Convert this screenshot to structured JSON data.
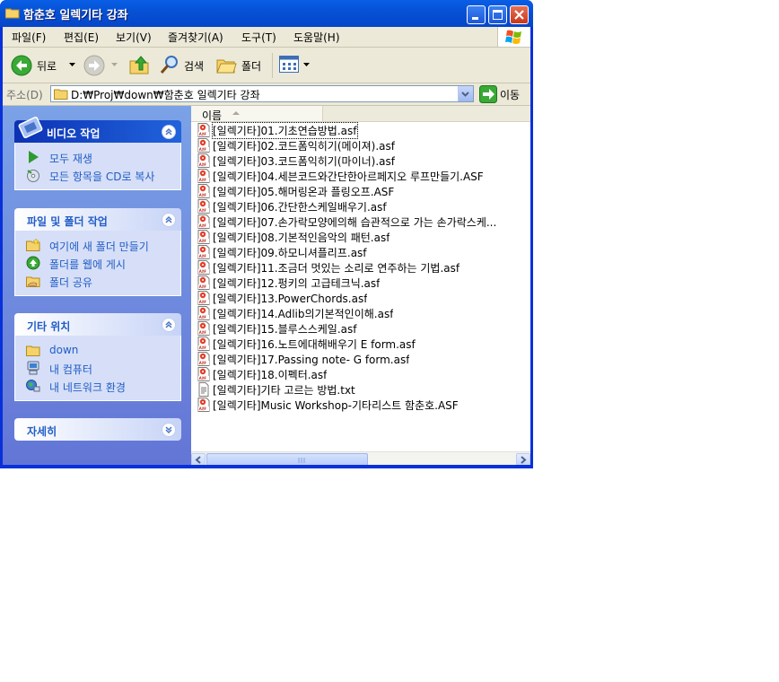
{
  "window": {
    "title": "함춘호 일렉기타 강좌",
    "minimize_icon": "minimize-icon",
    "maximize_icon": "maximize-icon",
    "close_icon": "close-icon"
  },
  "menu": [
    {
      "label": "파일(F)"
    },
    {
      "label": "편집(E)"
    },
    {
      "label": "보기(V)"
    },
    {
      "label": "즐겨찾기(A)"
    },
    {
      "label": "도구(T)"
    },
    {
      "label": "도움말(H)"
    }
  ],
  "toolbar": {
    "back_label": "뒤로",
    "search_label": "검색",
    "folders_label": "폴더"
  },
  "address": {
    "label": "주소(D)",
    "value": "D:₩Proj₩down₩함춘호 일렉기타 강좌",
    "go_label": "이동"
  },
  "tasks": {
    "video": {
      "title": "비디오 작업",
      "items": [
        {
          "label": "모두 재생",
          "icon": "play-icon"
        },
        {
          "label": "모든 항목을 CD로 복사",
          "icon": "burn-cd-icon"
        }
      ]
    },
    "file": {
      "title": "파일 및 폴더 작업",
      "items": [
        {
          "label": "여기에 새 폴더 만들기",
          "icon": "new-folder-icon"
        },
        {
          "label": "폴더를 웹에 게시",
          "icon": "publish-web-icon"
        },
        {
          "label": "폴더 공유",
          "icon": "share-folder-icon"
        }
      ]
    },
    "places": {
      "title": "기타 위치",
      "items": [
        {
          "label": "down",
          "icon": "folder-icon"
        },
        {
          "label": "내 컴퓨터",
          "icon": "computer-icon"
        },
        {
          "label": "내 네트워크 환경",
          "icon": "network-icon"
        }
      ]
    },
    "details": {
      "title": "자세히"
    }
  },
  "list": {
    "column_name": "이름",
    "files": [
      {
        "name": "[일렉기타]01.기초연습방법.asf",
        "type": "asf"
      },
      {
        "name": "[일렉기타]02.코드폼익히기(메이져).asf",
        "type": "asf"
      },
      {
        "name": "[일렉기타]03.코드폼익히기(마이너).asf",
        "type": "asf"
      },
      {
        "name": "[일렉기타]04.세븐코드와간단한아르페지오 루프만들기.ASF",
        "type": "asf"
      },
      {
        "name": "[일렉기타]05.해머링온과 플링오프.ASF",
        "type": "asf"
      },
      {
        "name": "[일렉기타]06.간단한스케일배우기.asf",
        "type": "asf"
      },
      {
        "name": "[일렉기타]07.손가락모양에의해 습관적으로 가는 손가락스케...",
        "type": "asf"
      },
      {
        "name": "[일렉기타]08.기본적인음악의 패턴.asf",
        "type": "asf"
      },
      {
        "name": "[일렉기타]09.하모니셔플리프.asf",
        "type": "asf"
      },
      {
        "name": "[일렉기타]11.조금더 멋있는 소리로 연주하는 기법.asf",
        "type": "asf"
      },
      {
        "name": "[일렉기타]12.펑키의 고급테크닉.asf",
        "type": "asf"
      },
      {
        "name": "[일렉기타]13.PowerChords.asf",
        "type": "asf"
      },
      {
        "name": "[일렉기타]14.Adlib의기본적인이해.asf",
        "type": "asf"
      },
      {
        "name": "[일렉기타]15.블루스스케일.asf",
        "type": "asf"
      },
      {
        "name": "[일렉기타]16.노트에대해배우기 E form.asf",
        "type": "asf"
      },
      {
        "name": "[일렉기타]17.Passing note- G form.asf",
        "type": "asf"
      },
      {
        "name": "[일렉기타]18.이펙터.asf",
        "type": "asf"
      },
      {
        "name": "[일렉기타]기타 고르는 방법.txt",
        "type": "txt"
      },
      {
        "name": "[일렉기타]Music Workshop-기타리스트 함춘호.ASF",
        "type": "asf"
      }
    ]
  },
  "colors": {
    "titlebar": "#0a5fe6",
    "taskpane": "#7ba2e7",
    "link": "#215dc6",
    "chrome": "#ece9d8"
  }
}
